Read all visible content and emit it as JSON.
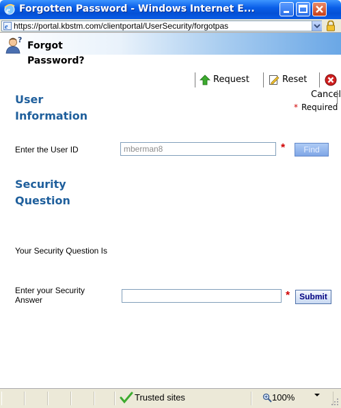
{
  "window": {
    "title": "Forgotten Password - Windows Internet E...",
    "controls": [
      "minimize",
      "maximize",
      "close"
    ]
  },
  "address_bar": {
    "url": "https://portal.kbstm.com/clientportal/UserSecurity/forgotpas",
    "page_icon": "ie-page-icon",
    "security_icon": "lock-icon"
  },
  "header": {
    "title": "Forgot Password?",
    "icon": "user-question-icon"
  },
  "toolbar": {
    "request_label": "Request",
    "reset_label": "Reset",
    "cancel_label": "Cancel"
  },
  "required_note": {
    "star": "*",
    "text": "Required"
  },
  "sections": {
    "user_information": "User Information",
    "security_question": "Security Question"
  },
  "form": {
    "user_id_label": "Enter the User ID",
    "user_id_value": "mberman8",
    "find_label": "Find",
    "security_question_label": "Your Security Question Is",
    "security_answer_label": "Enter your Security Answer",
    "security_answer_value": "",
    "submit_label": "Submit",
    "required_star": "*"
  },
  "status_bar": {
    "zone": "Trusted sites",
    "zoom": "100%"
  },
  "colors": {
    "heading": "#1f5f9c",
    "required": "#d00000",
    "titlebar": "#0a5fe8"
  }
}
